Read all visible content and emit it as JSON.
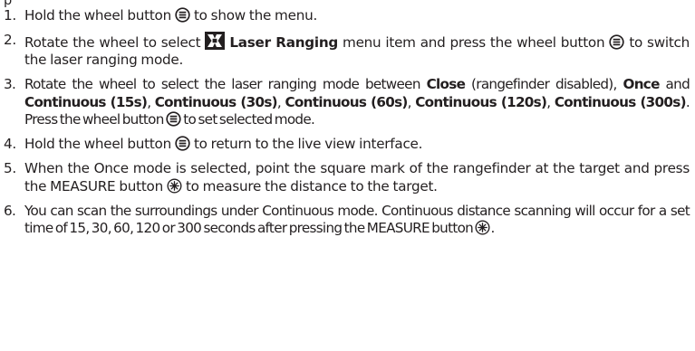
{
  "intro_fragment": "p",
  "steps": [
    {
      "num": "1.",
      "t1": "Hold the wheel button",
      "t2": "to show the menu.",
      "icon1": "wheel-button-icon"
    },
    {
      "num": "2.",
      "t1": "Rotate the wheel to select",
      "menu_item": "Laser Ranging",
      "t2": "menu item and press the wheel button",
      "t3": "to switch the laser ranging mode.",
      "icon1": "laser-ranging-icon",
      "icon2": "wheel-button-icon"
    },
    {
      "num": "3.",
      "t1": "Rotate the wheel to select the laser ranging mode between",
      "mode_close": "Close",
      "t2": "(rangefinder disabled),",
      "mode_once": "Once",
      "t3": "and",
      "mode_c15": "Continuous (15s)",
      "mode_c30": "Continuous (30s)",
      "mode_c60": "Continuous (60s)",
      "mode_c120": "Continuous (120s)",
      "mode_c300": "Continuous (300s)",
      "sep": ",",
      "t4": ". Press the wheel button",
      "t5": "to set selected mode.",
      "icon1": "wheel-button-icon"
    },
    {
      "num": "4.",
      "t1": "Hold the wheel button",
      "t2": "to return to the live view interface.",
      "icon1": "wheel-button-icon"
    },
    {
      "num": "5.",
      "t1": "When the Once mode is selected, point the square mark of the rangefinder at the target and press the MEASURE button",
      "t2": "to measure the distance to the target.",
      "icon1": "measure-button-icon"
    },
    {
      "num": "6.",
      "t1": "You can scan the surroundings under Continuous mode. Continuous distance scanning will occur for a set time of 15, 30, 60, 120 or 300 seconds after pressing the MEASURE button",
      "t2": ".",
      "icon1": "measure-button-icon"
    }
  ],
  "colors": {
    "text": "#231f20",
    "icon": "#231f20"
  }
}
